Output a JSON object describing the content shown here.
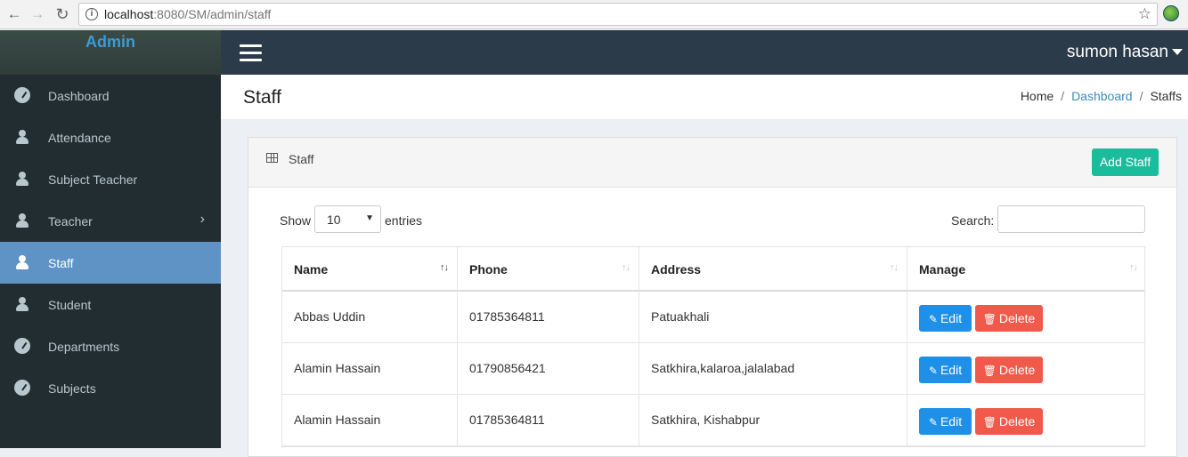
{
  "browser": {
    "url_host": "localhost",
    "url_path": ":8080/SM/admin/staff"
  },
  "sidebar": {
    "logo": "Admin",
    "items": [
      {
        "label": "Dashboard",
        "icon": "dashboard-icon"
      },
      {
        "label": "Attendance",
        "icon": "user-icon"
      },
      {
        "label": "Subject Teacher",
        "icon": "user-icon"
      },
      {
        "label": "Teacher",
        "icon": "user-icon"
      },
      {
        "label": "Staff",
        "icon": "user-icon",
        "active": true
      },
      {
        "label": "Student",
        "icon": "user-icon"
      },
      {
        "label": "Departments",
        "icon": "dashboard-icon"
      },
      {
        "label": "Subjects",
        "icon": "dashboard-icon"
      }
    ]
  },
  "topbar": {
    "user_name": "sumon hasan"
  },
  "header": {
    "title": "Staff",
    "breadcrumb": [
      "Home",
      "Dashboard",
      "Staffs"
    ]
  },
  "box": {
    "title": "Staff",
    "add_button": "Add Staff",
    "show_label": "Show",
    "entries_value": "10",
    "entries_label": "entries",
    "search_label": "Search:"
  },
  "table": {
    "columns": [
      "Name",
      "Phone",
      "Address",
      "Manage"
    ],
    "rows": [
      {
        "name": "Abbas Uddin",
        "phone": "01785364811",
        "address": "Patuakhali"
      },
      {
        "name": "Alamin Hassain",
        "phone": "01790856421",
        "address": "Satkhira,kalaroa,jalalabad"
      },
      {
        "name": "Alamin Hassain",
        "phone": "01785364811",
        "address": "Satkhira, Kishabpur"
      }
    ],
    "edit_label": "Edit",
    "delete_label": "Delete"
  },
  "colors": {
    "sidebar_bg": "#222d32",
    "active_item": "#5f93c6",
    "topbar_bg": "#2c3b4a",
    "add_button": "#1abc9c",
    "edit_button": "#1e90e8",
    "delete_button": "#f15a4a"
  }
}
